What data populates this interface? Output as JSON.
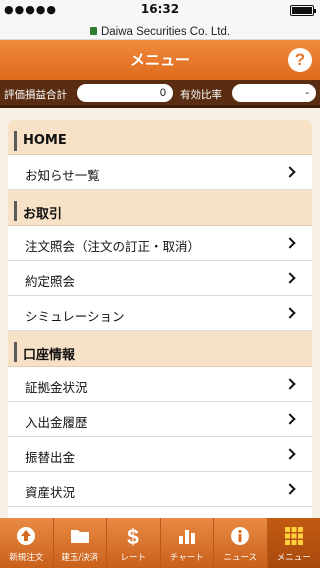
{
  "status_bar": {
    "signal": "●●●●● ",
    "time": "16:32"
  },
  "url_bar": {
    "url": "Daiwa Securities Co. Ltd."
  },
  "header": {
    "title": "メニュー",
    "help": "?"
  },
  "summary": {
    "label1": "評価損益合計",
    "value1": "0",
    "label2": "有効比率",
    "value2": "-"
  },
  "sections": [
    {
      "title": "HOME",
      "items": [
        {
          "label": "お知らせ一覧"
        }
      ]
    },
    {
      "title": "お取引",
      "items": [
        {
          "label": "注文照会（注文の訂正・取消）"
        },
        {
          "label": "約定照会"
        },
        {
          "label": "シミュレーション"
        }
      ]
    },
    {
      "title": "口座情報",
      "items": [
        {
          "label": "証拠金状況"
        },
        {
          "label": "入出金履歴"
        },
        {
          "label": "振替出金"
        },
        {
          "label": "資産状況"
        }
      ]
    }
  ],
  "tabs": [
    {
      "label": "新規注文",
      "icon": "new-order-icon"
    },
    {
      "label": "建玉/決済",
      "icon": "folder-icon"
    },
    {
      "label": "レート",
      "icon": "dollar-icon"
    },
    {
      "label": "チャート",
      "icon": "chart-icon"
    },
    {
      "label": "ニュース",
      "icon": "info-icon"
    },
    {
      "label": "メニュー",
      "icon": "grid-icon"
    }
  ],
  "colors": {
    "header": "#e8782a",
    "summary": "#5a2d12",
    "section": "#f7e2c7",
    "tab_active": "#b0500f"
  }
}
